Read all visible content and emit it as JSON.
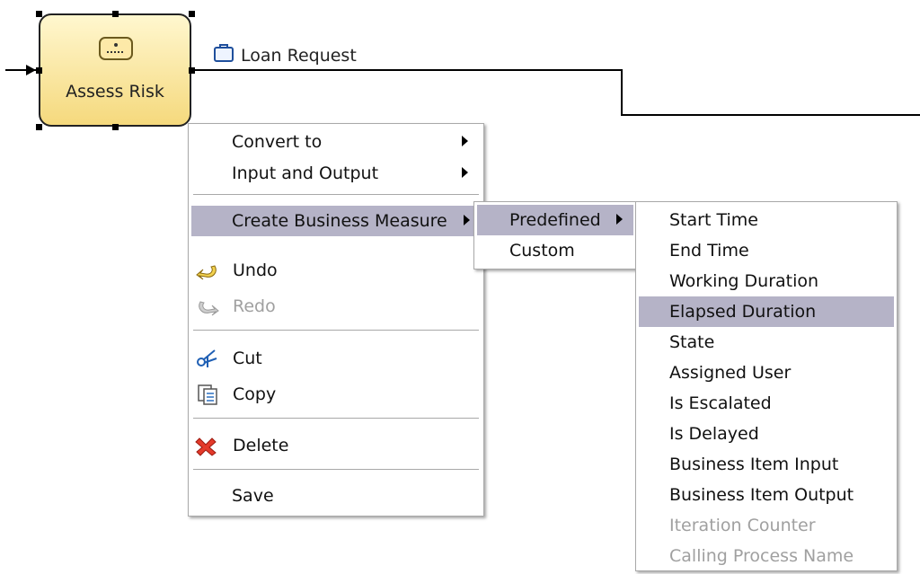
{
  "diagram": {
    "task_label": "Assess Risk",
    "flow_label": "Loan Request"
  },
  "context_menu": {
    "items": [
      {
        "label": "Convert to"
      },
      {
        "label": "Input and Output"
      },
      {
        "label": "Create Business Measure"
      },
      {
        "label": "Undo"
      },
      {
        "label": "Redo"
      },
      {
        "label": "Cut"
      },
      {
        "label": "Copy"
      },
      {
        "label": "Delete"
      },
      {
        "label": "Save"
      }
    ]
  },
  "submenu": {
    "items": [
      {
        "label": "Predefined"
      },
      {
        "label": "Custom"
      }
    ]
  },
  "predefined_menu": {
    "items": [
      {
        "label": "Start Time"
      },
      {
        "label": "End Time"
      },
      {
        "label": "Working Duration"
      },
      {
        "label": "Elapsed Duration"
      },
      {
        "label": "State"
      },
      {
        "label": "Assigned User"
      },
      {
        "label": "Is Escalated"
      },
      {
        "label": "Is Delayed"
      },
      {
        "label": "Business Item Input"
      },
      {
        "label": "Business Item Output"
      },
      {
        "label": "Iteration Counter"
      },
      {
        "label": "Calling Process Name"
      }
    ]
  },
  "icons": {
    "task": "task-icon",
    "business_item": "business-item-icon",
    "undo": "undo-icon",
    "redo": "redo-icon",
    "cut": "scissors-icon",
    "copy": "copy-icon",
    "delete": "delete-x-icon"
  },
  "colors": {
    "selection": "#b5b3c7",
    "task_fill_top": "#fff7cf",
    "task_fill_bottom": "#f5d97d",
    "disabled_text": "#a0a0a0"
  }
}
